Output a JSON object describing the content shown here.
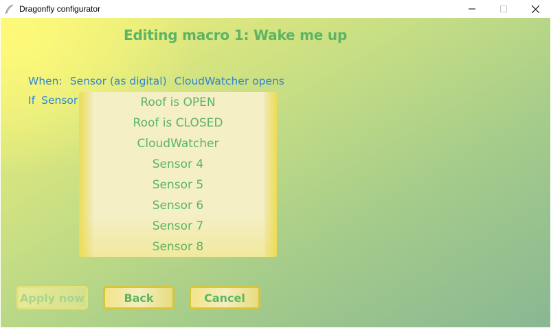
{
  "window": {
    "title": "Dragonfly configurator",
    "app_icon": "feather-icon",
    "controls": [
      "minimize-icon",
      "maximize-icon",
      "close-icon"
    ]
  },
  "editor": {
    "heading": "Editing macro 1: Wake me up",
    "when": {
      "label": "When:",
      "trigger_type": "Sensor (as digital)",
      "trigger_subject": "CloudWatcher opens"
    },
    "condition": {
      "if_label": "If",
      "sensor_label": "Sensor"
    },
    "sensor_options": [
      "Roof is OPEN",
      "Roof is CLOSED",
      "CloudWatcher",
      "Sensor 4",
      "Sensor 5",
      "Sensor 6",
      "Sensor 7",
      "Sensor 8"
    ]
  },
  "buttons": {
    "apply_label": "Apply now",
    "back_label": "Back",
    "cancel_label": "Cancel"
  },
  "colors": {
    "heading": "#5cb464",
    "link_text": "#2e86d6",
    "button_border": "#d7c63b"
  }
}
